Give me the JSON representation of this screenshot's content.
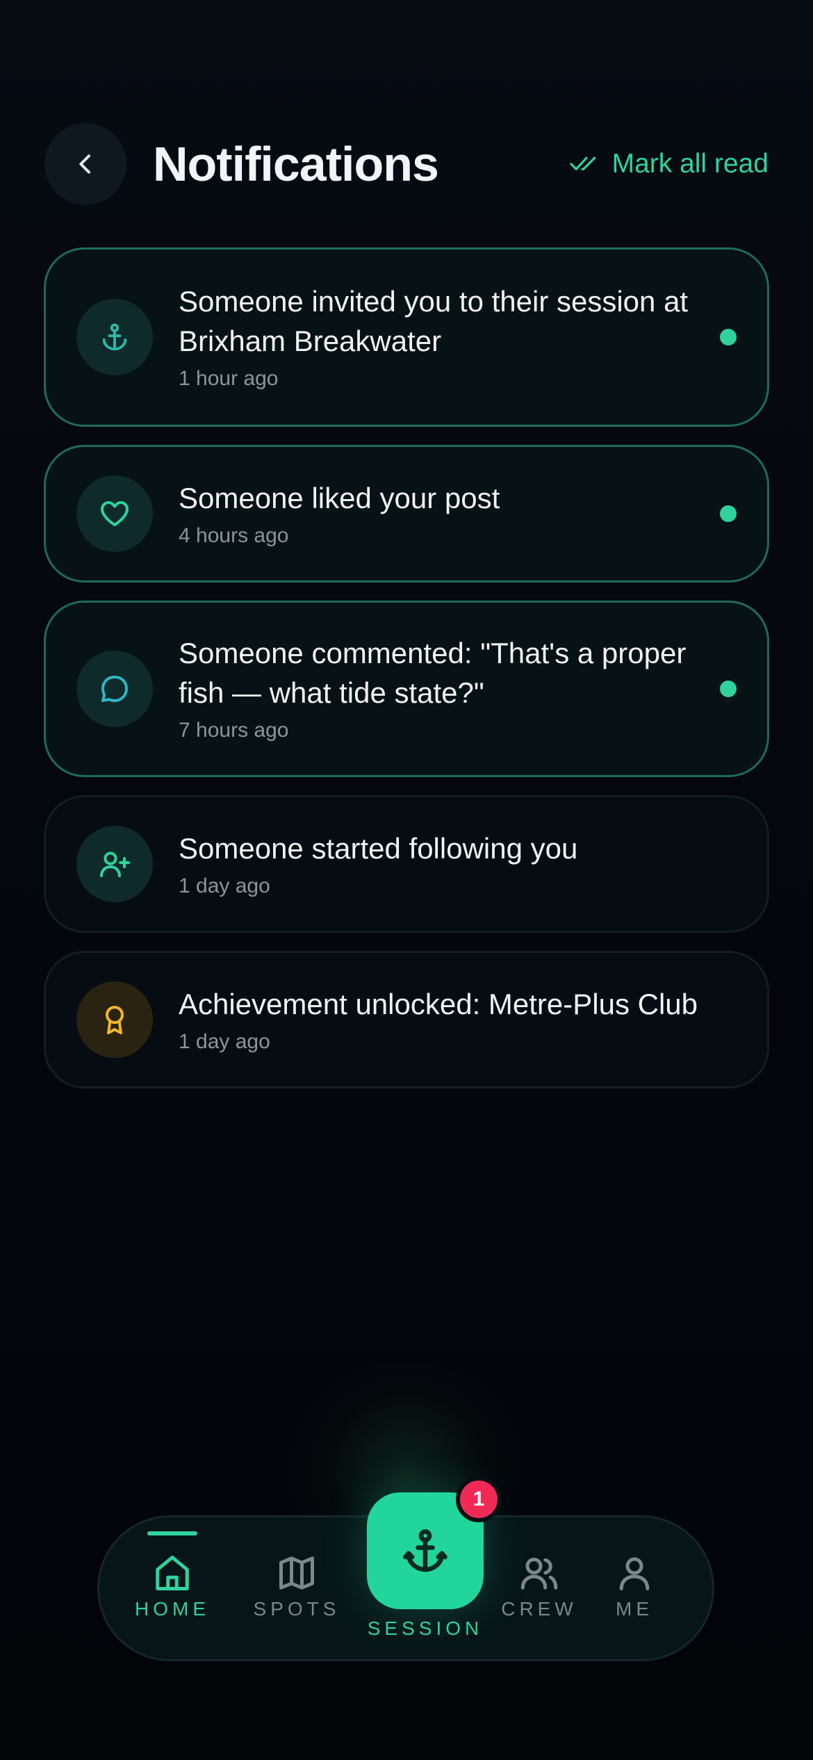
{
  "header": {
    "title": "Notifications",
    "mark_all_label": "Mark all read"
  },
  "notifications": [
    {
      "title": "Someone invited you to their session at Brixham Breakwater",
      "time": "1 hour ago",
      "icon": "anchor-icon",
      "unread": true
    },
    {
      "title": "Someone liked your post",
      "time": "4 hours ago",
      "icon": "heart-icon",
      "unread": true
    },
    {
      "title": "Someone commented: \"That's a proper fish — what tide state?\"",
      "time": "7 hours ago",
      "icon": "comment-icon",
      "unread": true
    },
    {
      "title": "Someone started following you",
      "time": "1 day ago",
      "icon": "user-plus-icon",
      "unread": false
    },
    {
      "title": "Achievement unlocked: Metre-Plus Club",
      "time": "1 day ago",
      "icon": "award-icon",
      "unread": false
    }
  ],
  "nav": {
    "home": "HOME",
    "spots": "SPOTS",
    "session": "SESSION",
    "crew": "CREW",
    "me": "ME",
    "session_badge": "1",
    "active": "home"
  },
  "colors": {
    "accent": "#2fd39b",
    "badge": "#f02a55",
    "gold": "#f2b627"
  }
}
